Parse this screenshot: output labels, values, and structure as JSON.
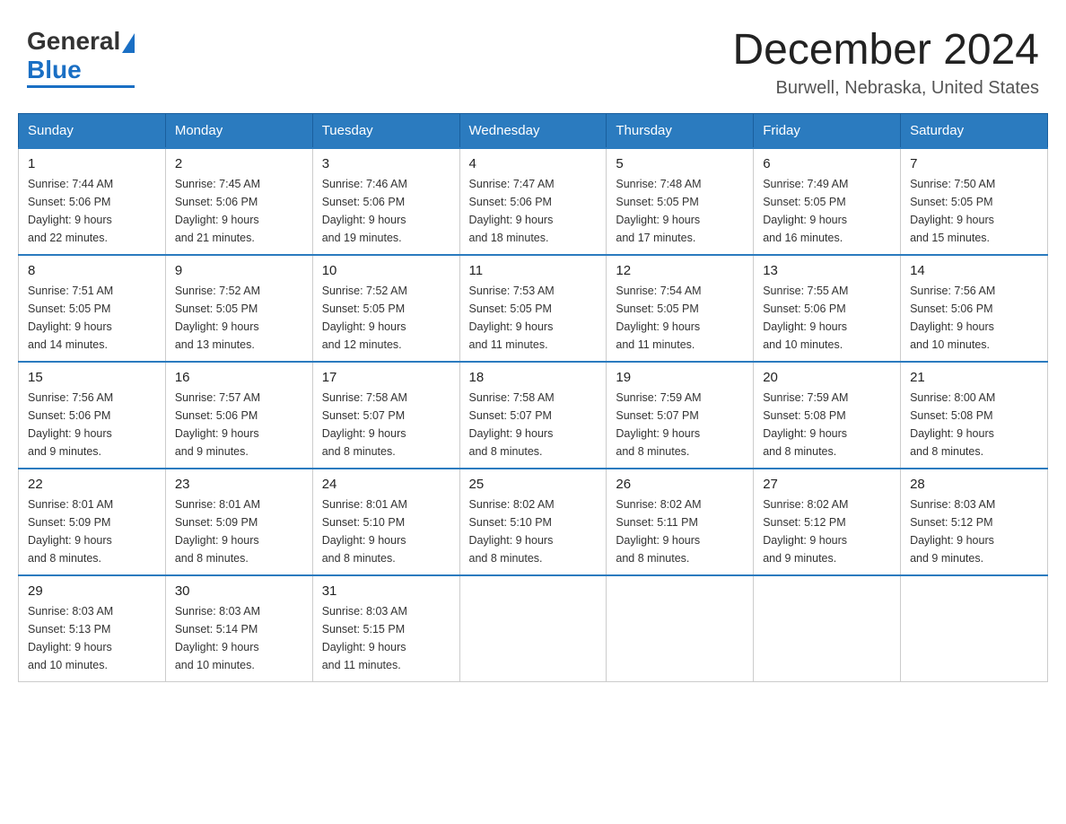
{
  "header": {
    "title": "December 2024",
    "subtitle": "Burwell, Nebraska, United States",
    "logo_word1": "General",
    "logo_word2": "Blue"
  },
  "calendar": {
    "days_of_week": [
      "Sunday",
      "Monday",
      "Tuesday",
      "Wednesday",
      "Thursday",
      "Friday",
      "Saturday"
    ],
    "weeks": [
      [
        {
          "day": "1",
          "sunrise": "7:44 AM",
          "sunset": "5:06 PM",
          "daylight": "9 hours and 22 minutes."
        },
        {
          "day": "2",
          "sunrise": "7:45 AM",
          "sunset": "5:06 PM",
          "daylight": "9 hours and 21 minutes."
        },
        {
          "day": "3",
          "sunrise": "7:46 AM",
          "sunset": "5:06 PM",
          "daylight": "9 hours and 19 minutes."
        },
        {
          "day": "4",
          "sunrise": "7:47 AM",
          "sunset": "5:06 PM",
          "daylight": "9 hours and 18 minutes."
        },
        {
          "day": "5",
          "sunrise": "7:48 AM",
          "sunset": "5:05 PM",
          "daylight": "9 hours and 17 minutes."
        },
        {
          "day": "6",
          "sunrise": "7:49 AM",
          "sunset": "5:05 PM",
          "daylight": "9 hours and 16 minutes."
        },
        {
          "day": "7",
          "sunrise": "7:50 AM",
          "sunset": "5:05 PM",
          "daylight": "9 hours and 15 minutes."
        }
      ],
      [
        {
          "day": "8",
          "sunrise": "7:51 AM",
          "sunset": "5:05 PM",
          "daylight": "9 hours and 14 minutes."
        },
        {
          "day": "9",
          "sunrise": "7:52 AM",
          "sunset": "5:05 PM",
          "daylight": "9 hours and 13 minutes."
        },
        {
          "day": "10",
          "sunrise": "7:52 AM",
          "sunset": "5:05 PM",
          "daylight": "9 hours and 12 minutes."
        },
        {
          "day": "11",
          "sunrise": "7:53 AM",
          "sunset": "5:05 PM",
          "daylight": "9 hours and 11 minutes."
        },
        {
          "day": "12",
          "sunrise": "7:54 AM",
          "sunset": "5:05 PM",
          "daylight": "9 hours and 11 minutes."
        },
        {
          "day": "13",
          "sunrise": "7:55 AM",
          "sunset": "5:06 PM",
          "daylight": "9 hours and 10 minutes."
        },
        {
          "day": "14",
          "sunrise": "7:56 AM",
          "sunset": "5:06 PM",
          "daylight": "9 hours and 10 minutes."
        }
      ],
      [
        {
          "day": "15",
          "sunrise": "7:56 AM",
          "sunset": "5:06 PM",
          "daylight": "9 hours and 9 minutes."
        },
        {
          "day": "16",
          "sunrise": "7:57 AM",
          "sunset": "5:06 PM",
          "daylight": "9 hours and 9 minutes."
        },
        {
          "day": "17",
          "sunrise": "7:58 AM",
          "sunset": "5:07 PM",
          "daylight": "9 hours and 8 minutes."
        },
        {
          "day": "18",
          "sunrise": "7:58 AM",
          "sunset": "5:07 PM",
          "daylight": "9 hours and 8 minutes."
        },
        {
          "day": "19",
          "sunrise": "7:59 AM",
          "sunset": "5:07 PM",
          "daylight": "9 hours and 8 minutes."
        },
        {
          "day": "20",
          "sunrise": "7:59 AM",
          "sunset": "5:08 PM",
          "daylight": "9 hours and 8 minutes."
        },
        {
          "day": "21",
          "sunrise": "8:00 AM",
          "sunset": "5:08 PM",
          "daylight": "9 hours and 8 minutes."
        }
      ],
      [
        {
          "day": "22",
          "sunrise": "8:01 AM",
          "sunset": "5:09 PM",
          "daylight": "9 hours and 8 minutes."
        },
        {
          "day": "23",
          "sunrise": "8:01 AM",
          "sunset": "5:09 PM",
          "daylight": "9 hours and 8 minutes."
        },
        {
          "day": "24",
          "sunrise": "8:01 AM",
          "sunset": "5:10 PM",
          "daylight": "9 hours and 8 minutes."
        },
        {
          "day": "25",
          "sunrise": "8:02 AM",
          "sunset": "5:10 PM",
          "daylight": "9 hours and 8 minutes."
        },
        {
          "day": "26",
          "sunrise": "8:02 AM",
          "sunset": "5:11 PM",
          "daylight": "9 hours and 8 minutes."
        },
        {
          "day": "27",
          "sunrise": "8:02 AM",
          "sunset": "5:12 PM",
          "daylight": "9 hours and 9 minutes."
        },
        {
          "day": "28",
          "sunrise": "8:03 AM",
          "sunset": "5:12 PM",
          "daylight": "9 hours and 9 minutes."
        }
      ],
      [
        {
          "day": "29",
          "sunrise": "8:03 AM",
          "sunset": "5:13 PM",
          "daylight": "9 hours and 10 minutes."
        },
        {
          "day": "30",
          "sunrise": "8:03 AM",
          "sunset": "5:14 PM",
          "daylight": "9 hours and 10 minutes."
        },
        {
          "day": "31",
          "sunrise": "8:03 AM",
          "sunset": "5:15 PM",
          "daylight": "9 hours and 11 minutes."
        },
        null,
        null,
        null,
        null
      ]
    ]
  }
}
